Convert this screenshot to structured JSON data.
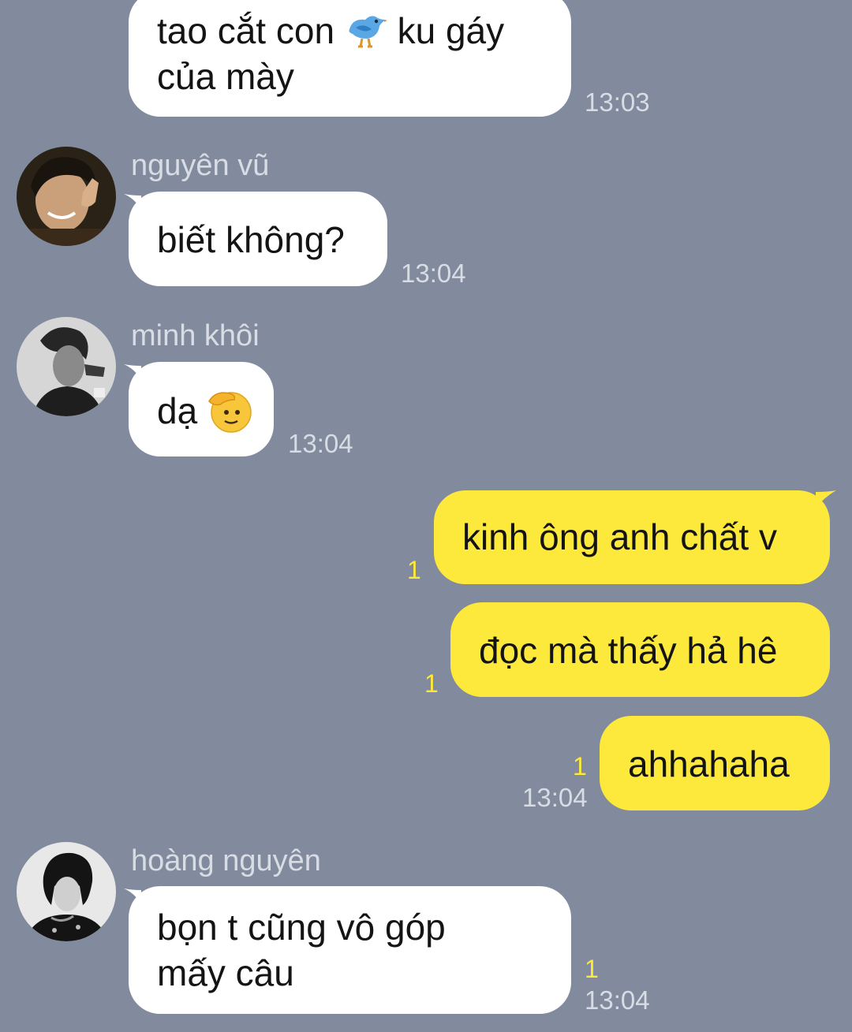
{
  "messages": [
    {
      "type": "incoming",
      "sender": "",
      "lines": [
        "tao cắt con",
        "ku gáy",
        "của mày"
      ],
      "emoji": "blue-bird-icon",
      "time": "13:03"
    },
    {
      "type": "incoming",
      "sender": "nguyên vũ",
      "lines": [
        "biết không?"
      ],
      "time": "13:04"
    },
    {
      "type": "incoming",
      "sender": "minh khôi",
      "lines": [
        "dạ"
      ],
      "emoji": "saluting-face-icon",
      "time": "13:04"
    },
    {
      "type": "outgoing",
      "lines": [
        "kinh ông anh chất v"
      ],
      "unread": "1"
    },
    {
      "type": "outgoing",
      "lines": [
        "đọc mà thấy hả hê"
      ],
      "unread": "1"
    },
    {
      "type": "outgoing",
      "lines": [
        "ahhahaha"
      ],
      "unread": "1",
      "time": "13:04"
    },
    {
      "type": "incoming",
      "sender": "hoàng nguyên",
      "lines": [
        "bọn t cũng vô góp",
        "mấy câu"
      ],
      "unread": "1",
      "time": "13:04"
    }
  ],
  "colors": {
    "background": "#828b9d",
    "incoming_bubble": "#ffffff",
    "outgoing_bubble": "#fde93c",
    "meta_text": "#d8dce4",
    "unread_count": "#fde93c"
  }
}
